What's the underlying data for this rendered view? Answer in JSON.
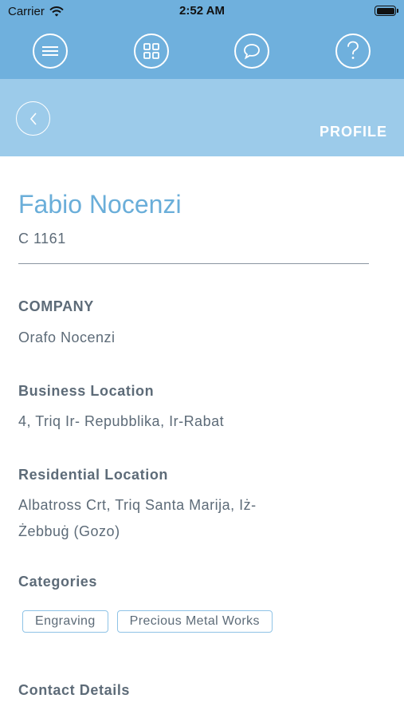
{
  "status_bar": {
    "carrier": "Carrier",
    "time": "2:52 AM"
  },
  "nav": {
    "icons": [
      "menu-icon",
      "grid-icon",
      "chat-icon",
      "help-icon"
    ]
  },
  "header": {
    "title": "PROFILE"
  },
  "profile": {
    "name": "Fabio Nocenzi",
    "code": "C 1161",
    "company_label": "COMPANY",
    "company": "Orafo Nocenzi",
    "business_label": "Business Location",
    "business_location": "4, Triq Ir- Repubblika, Ir-Rabat",
    "residential_label": "Residential Location",
    "residential_location": "Albatross Crt, Triq Santa Marija, Iż-Żebbuġ (Gozo)",
    "categories_label": "Categories",
    "categories": [
      "Engraving",
      "Precious Metal Works"
    ],
    "contact_label": "Contact Details"
  },
  "colors": {
    "nav": "#6fb0dd",
    "subheader": "#9ccbea",
    "accent": "#6aaed9",
    "text": "#5d6b78"
  }
}
